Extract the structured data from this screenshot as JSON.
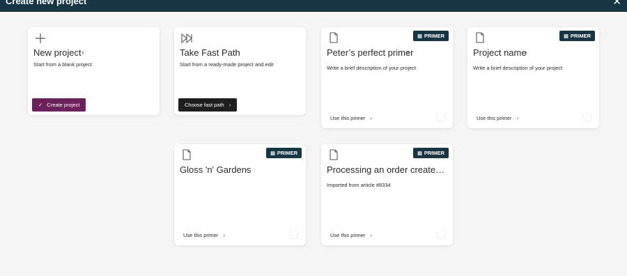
{
  "header": {
    "title": "Create new project",
    "close_icon": "close-icon"
  },
  "cards": {
    "new_project": {
      "title": "New project",
      "description": "Start from a blank project",
      "button_label": "Create project",
      "icon": "plus-icon"
    },
    "fast_path": {
      "title": "Take Fast Path",
      "description": "Start from a ready-made project and edit",
      "button_label": "Choose fast path",
      "icon": "fast-forward-icon"
    },
    "primers": [
      {
        "title": "Peter’s perfect primer",
        "description": "Write a brief description of your project",
        "badge": "PRIMER",
        "action": "Use this primer"
      },
      {
        "title": "Project name",
        "description": "Write a brief description of your project",
        "badge": "PRIMER",
        "action": "Use this primer"
      },
      {
        "title": "Gloss 'n' Gardens",
        "description": "",
        "badge": "PRIMER",
        "action": "Use this primer"
      },
      {
        "title": "Processing an order created in…",
        "description": "Imported from article #8334",
        "badge": "PRIMER",
        "action": "Use this primer"
      }
    ]
  },
  "colors": {
    "header": "#173543",
    "primary_button": "#6b2159",
    "dark_button": "#1e1e1e",
    "badge": "#173543"
  }
}
